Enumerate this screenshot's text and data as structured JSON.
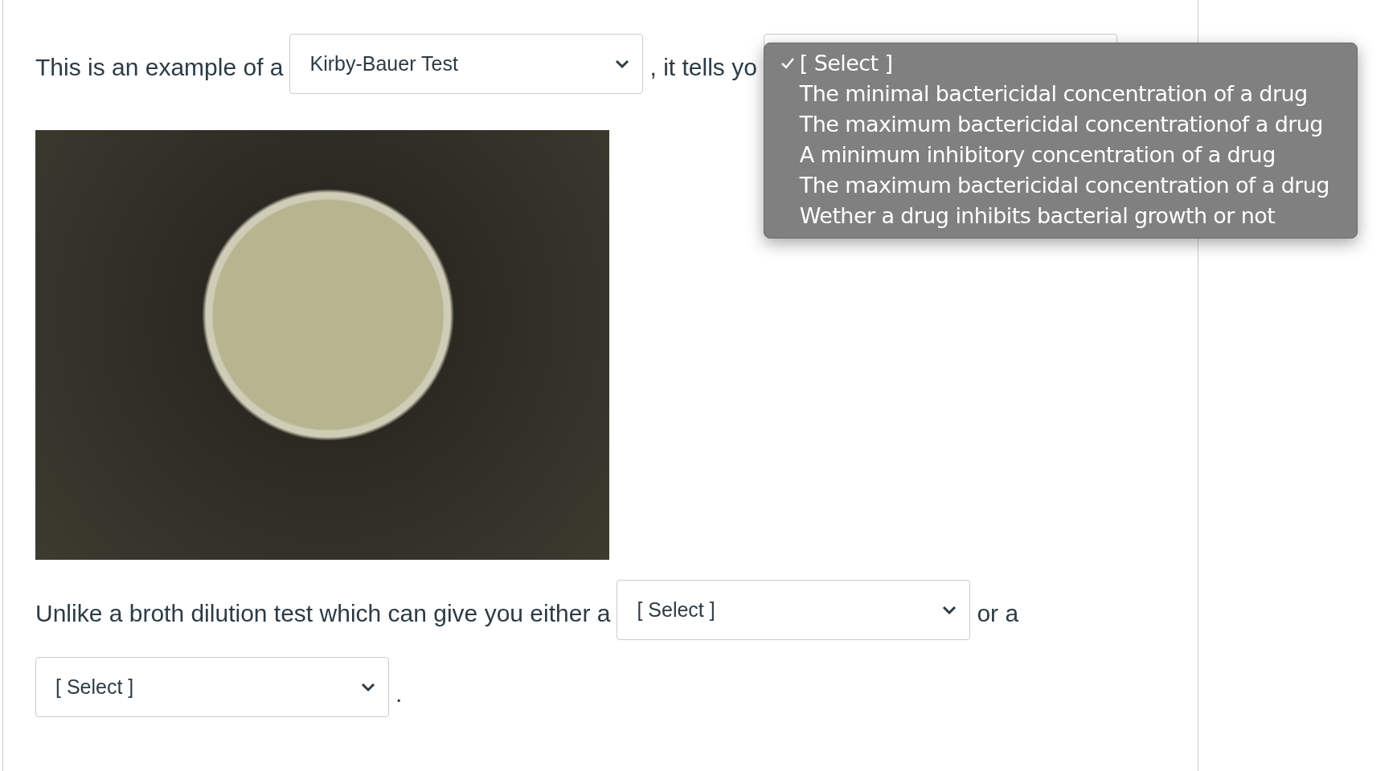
{
  "line_1": {
    "before": "This is an example of a",
    "select": {
      "value": "Kirby-Bauer Test"
    },
    "after": ", it tells yo",
    "select_2": {
      "open": true,
      "options": [
        {
          "label": "[ Select ]",
          "selected": true
        },
        {
          "label": "The minimal bactericidal concentration of a drug",
          "selected": false
        },
        {
          "label": "The maximum bactericidal concentrationof a drug",
          "selected": false
        },
        {
          "label": "A minimum inhibitory concentration of a drug",
          "selected": false
        },
        {
          "label": "The maximum bactericidal concentration of a drug",
          "selected": false
        },
        {
          "label": "Wether a drug inhibits bacterial growth or not",
          "selected": false
        }
      ]
    }
  },
  "line_2": {
    "before": "Unlike a broth dilution test which can give you either a",
    "select": {
      "value": "[ Select ]"
    },
    "after": "or a"
  },
  "line_3": {
    "select": {
      "value": "[ Select ]"
    },
    "after": "."
  }
}
